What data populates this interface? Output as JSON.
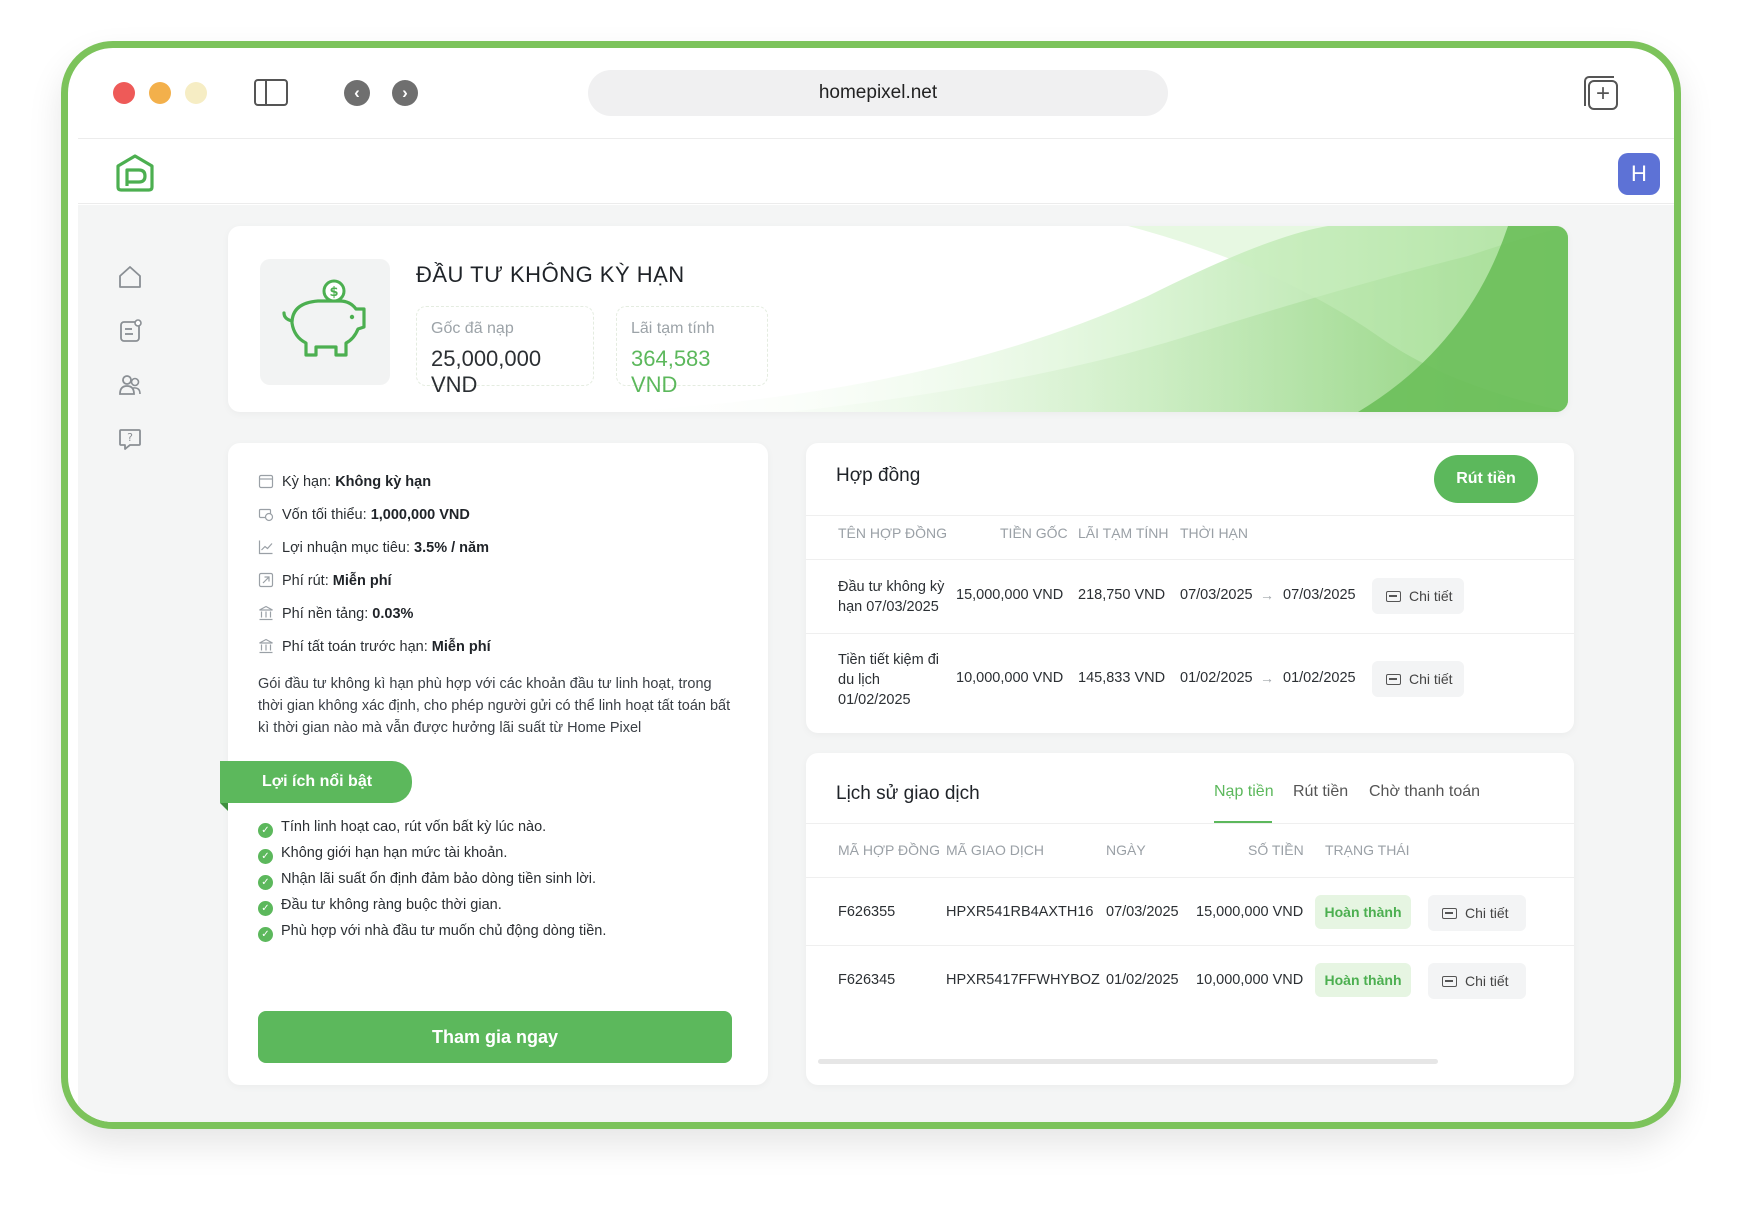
{
  "browser": {
    "url": "homepixel.net"
  },
  "header": {
    "avatar_letter": "H"
  },
  "hero": {
    "title": "ĐẦU TƯ KHÔNG KỲ HẠN",
    "principal_label": "Gốc đã nạp",
    "principal_value": "25,000,000 VND",
    "interest_label": "Lãi tạm tính",
    "interest_value": "364,583 VND",
    "interest_color": "#5cb85c"
  },
  "info": {
    "term_label": "Kỳ hạn:",
    "term_value": "Không kỳ hạn",
    "min_capital_label": "Vốn tối thiểu:",
    "min_capital_value": "1,000,000 VND",
    "target_profit_label": "Lợi nhuận mục tiêu:",
    "target_profit_value": "3.5% / năm",
    "withdraw_fee_label": "Phí rút:",
    "withdraw_fee_value": "Miễn phí",
    "platform_fee_label": "Phí nền tảng:",
    "platform_fee_value": "0.03%",
    "early_settle_label": "Phí tất toán trước hạn:",
    "early_settle_value": "Miễn phí",
    "description": "Gói đầu tư không kì hạn phù hợp với các khoản đầu tư linh hoạt, trong thời gian không xác định, cho phép người gửi có thể linh hoạt tất toán bất kì thời gian nào mà vẫn được hưởng lãi suất từ Home Pixel",
    "benefits_title": "Lợi ích nổi bật",
    "benefits": [
      "Tính linh hoạt cao, rút vốn bất kỳ lúc nào.",
      "Không giới hạn hạn mức tài khoản.",
      "Nhận lãi suất ổn định đảm bảo dòng tiền sinh lời.",
      "Đầu tư không ràng buộc thời gian.",
      "Phù hợp với nhà đầu tư muốn chủ động dòng tiền."
    ],
    "join_label": "Tham gia ngay"
  },
  "contracts": {
    "title": "Hợp đồng",
    "withdraw_label": "Rút tiền",
    "columns": [
      "TÊN HỢP ĐỒNG",
      "TIỀN GỐC",
      "LÃI TẠM TÍNH",
      "THỜI HẠN"
    ],
    "rows": [
      {
        "name": "Đầu tư không kỳ hạn 07/03/2025",
        "principal": "15,000,000 VND",
        "interest": "218,750 VND",
        "from": "07/03/2025",
        "to": "07/03/2025",
        "detail": "Chi tiết"
      },
      {
        "name": "Tiền tiết kiệm đi du lịch 01/02/2025",
        "principal": "10,000,000 VND",
        "interest": "145,833 VND",
        "from": "01/02/2025",
        "to": "01/02/2025",
        "detail": "Chi tiết"
      }
    ]
  },
  "history": {
    "title": "Lịch sử giao dịch",
    "tabs": [
      "Nạp tiền",
      "Rút tiền",
      "Chờ thanh toán"
    ],
    "columns": [
      "MÃ HỢP ĐỒNG",
      "MÃ GIAO DỊCH",
      "NGÀY",
      "SỐ TIỀN",
      "TRẠNG THÁI"
    ],
    "rows": [
      {
        "contract": "F626355",
        "txn": "HPXR541RB4AXTH16",
        "date": "07/03/2025",
        "amount": "15,000,000 VND",
        "status": "Hoàn thành",
        "detail": "Chi tiết"
      },
      {
        "contract": "F626345",
        "txn": "HPXR5417FFWHYBOZ",
        "date": "01/02/2025",
        "amount": "10,000,000 VND",
        "status": "Hoàn thành",
        "detail": "Chi tiết"
      }
    ]
  }
}
